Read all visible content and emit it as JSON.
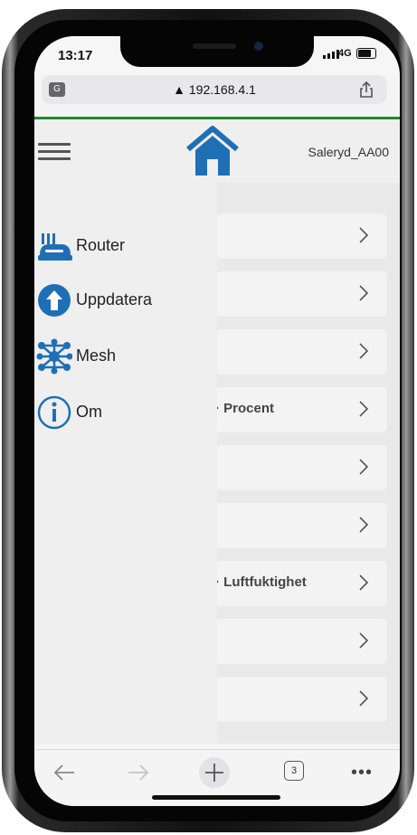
{
  "status": {
    "time": "13:17",
    "network": "4G"
  },
  "browser": {
    "url": "192.168.4.1",
    "tab_count": "3"
  },
  "header": {
    "device_name": "Saleryd_AA00"
  },
  "drawer": {
    "items": [
      {
        "label": "Router",
        "icon": "router-icon"
      },
      {
        "label": "Uppdatera",
        "icon": "update-arrow-icon"
      },
      {
        "label": "Mesh",
        "icon": "mesh-network-icon"
      },
      {
        "label": "Om",
        "icon": "info-icon"
      }
    ]
  },
  "list": {
    "rows": [
      {
        "label": ""
      },
      {
        "label": ""
      },
      {
        "label": ""
      },
      {
        "label": "· Procent"
      },
      {
        "label": ""
      },
      {
        "label": ""
      },
      {
        "label": "· Luftfuktighet"
      },
      {
        "label": ""
      },
      {
        "label": ""
      }
    ]
  },
  "colors": {
    "accent_green": "#1f8a2b",
    "icon_blue": "#1f6fb6"
  }
}
